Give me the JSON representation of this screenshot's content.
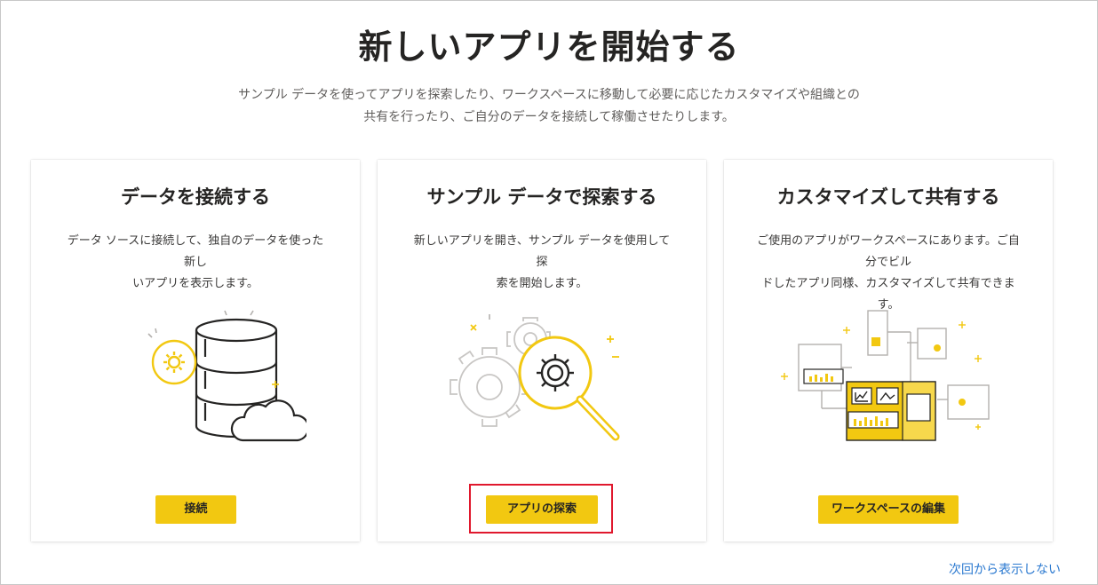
{
  "header": {
    "title": "新しいアプリを開始する",
    "subtitle_line1": "サンプル データを使ってアプリを探索したり、ワークスペースに移動して必要に応じたカスタマイズや組織との",
    "subtitle_line2": "共有を行ったり、ご自分のデータを接続して稼働させたりします。"
  },
  "cards": [
    {
      "title": "データを接続する",
      "description_line1": "データ ソースに接続して、独自のデータを使った新し",
      "description_line2": "いアプリを表示します。",
      "button_label": "接続",
      "illustration_icon": "database-cloud-icon"
    },
    {
      "title": "サンプル データで探索する",
      "description_line1": "新しいアプリを開き、サンプル データを使用して探",
      "description_line2": "索を開始します。",
      "button_label": "アプリの探索",
      "illustration_icon": "gears-magnifier-icon"
    },
    {
      "title": "カスタマイズして共有する",
      "description_line1": "ご使用のアプリがワークスペースにあります。ご自分でビル",
      "description_line2": "ドしたアプリ同様、カスタマイズして共有できます。",
      "button_label": "ワークスペースの編集",
      "illustration_icon": "dashboard-network-icon"
    }
  ],
  "footer": {
    "dont_show_label": "次回から表示しない"
  },
  "colors": {
    "accent": "#f2c811",
    "highlight_box": "#e0182d",
    "link": "#2b79d0"
  }
}
